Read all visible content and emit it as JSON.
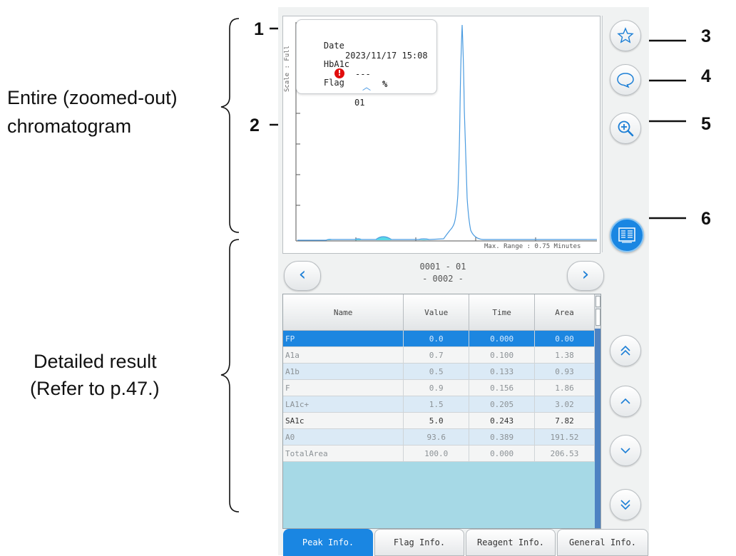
{
  "annotations": {
    "chromatogram_caption": [
      "Entire (zoomed-out)",
      "chromatogram"
    ],
    "detail_caption": [
      "Detailed result",
      "(Refer to p.47.)"
    ],
    "callouts": [
      "1",
      "2",
      "3",
      "4",
      "5",
      "6"
    ]
  },
  "chart": {
    "scale_label": "Scale : Full",
    "range_label": "Max. Range : 0.75 Minutes"
  },
  "info": {
    "date_label": "Date",
    "date_value": "2023/11/17 15:08",
    "hba1c_label": "HbA1c",
    "hba1c_value": "---",
    "hba1c_unit": "%",
    "flag_label": "Flag",
    "flag_icon": "!",
    "flag_value": "01",
    "collapse_icon": "︿"
  },
  "side_buttons": [
    "star-icon",
    "comment-icon",
    "zoom-in-icon",
    "report-icon"
  ],
  "sample_nav": {
    "line1": "0001 - 01",
    "line2": "- 0002 -",
    "prev": "‹",
    "next": "›"
  },
  "table": {
    "headers": [
      "Name",
      "Value",
      "Time",
      "Area"
    ],
    "rows": [
      {
        "name": "FP",
        "value": "0.0",
        "time": "0.000",
        "area": "0.00"
      },
      {
        "name": "A1a",
        "value": "0.7",
        "time": "0.100",
        "area": "1.38"
      },
      {
        "name": "A1b",
        "value": "0.5",
        "time": "0.133",
        "area": "0.93"
      },
      {
        "name": "F",
        "value": "0.9",
        "time": "0.156",
        "area": "1.86"
      },
      {
        "name": "LA1c+",
        "value": "1.5",
        "time": "0.205",
        "area": "3.02"
      },
      {
        "name": "SA1c",
        "value": "5.0",
        "time": "0.243",
        "area": "7.82"
      },
      {
        "name": "A0",
        "value": "93.6",
        "time": "0.389",
        "area": "191.52"
      },
      {
        "name": "TotalArea",
        "value": "100.0",
        "time": "0.000",
        "area": "206.53"
      }
    ]
  },
  "scroll_buttons": [
    "double-up-icon",
    "up-icon",
    "down-icon",
    "double-down-icon"
  ],
  "tabs": [
    "Peak Info.",
    "Flag Info.",
    "Reagent Info.",
    "General Info."
  ],
  "colors": {
    "accent": "#1a86e2",
    "chart_line": "#4a9be0",
    "peak_fill": "#58d8e6",
    "flag": "#e10d0d",
    "table_bg": "#a6d9e6"
  }
}
